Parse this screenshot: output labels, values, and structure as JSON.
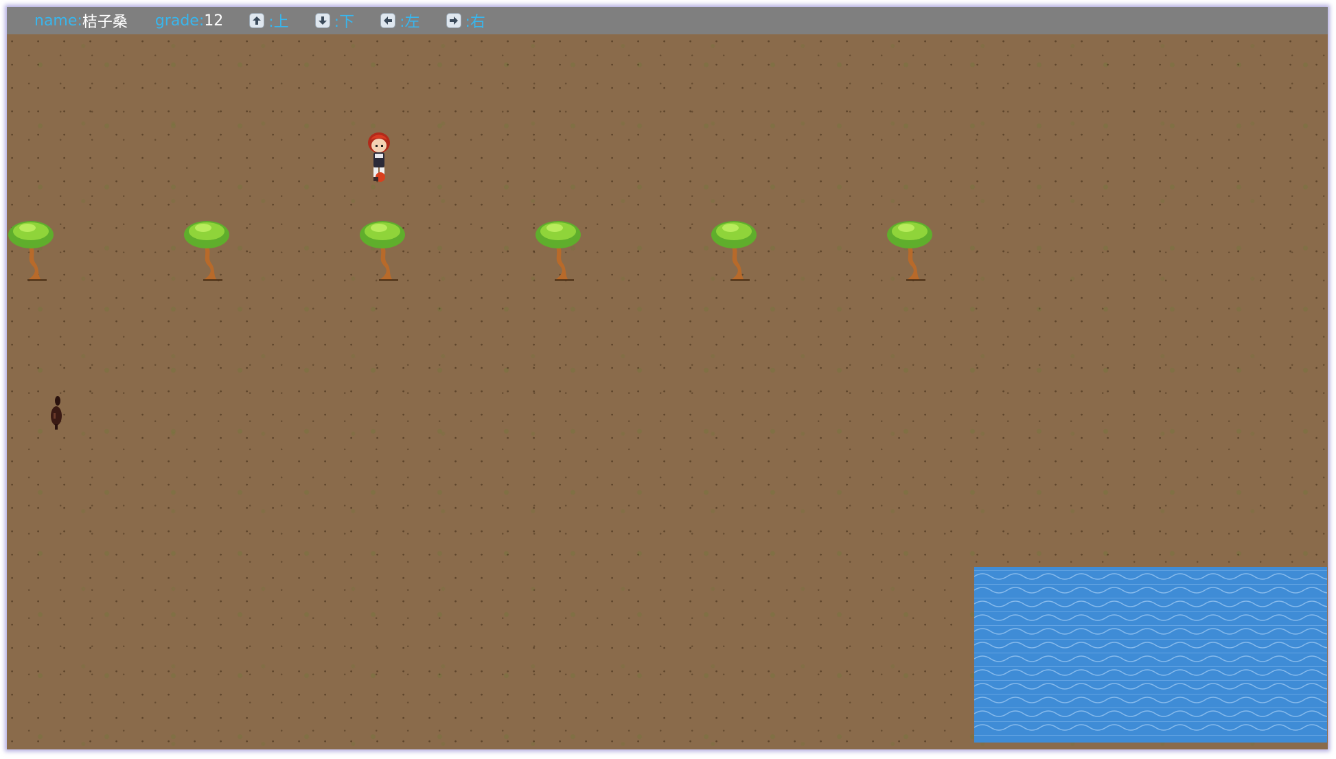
{
  "hud": {
    "name_label": "name:",
    "name_value": "桔子桑",
    "grade_label": "grade:",
    "grade_value": "12",
    "controls": [
      {
        "key_icon": "arrow-up-icon",
        "label": ":上"
      },
      {
        "key_icon": "arrow-down-icon",
        "label": ":下"
      },
      {
        "key_icon": "arrow-left-icon",
        "label": ":左"
      },
      {
        "key_icon": "arrow-right-icon",
        "label": ":右"
      }
    ]
  },
  "scene": {
    "tree_count": 6,
    "colors": {
      "ground": "#8a6b4b",
      "water": "#3f8cd6",
      "hud_bar": "#7f7f7f",
      "hud_accent": "#38b6ee"
    }
  }
}
